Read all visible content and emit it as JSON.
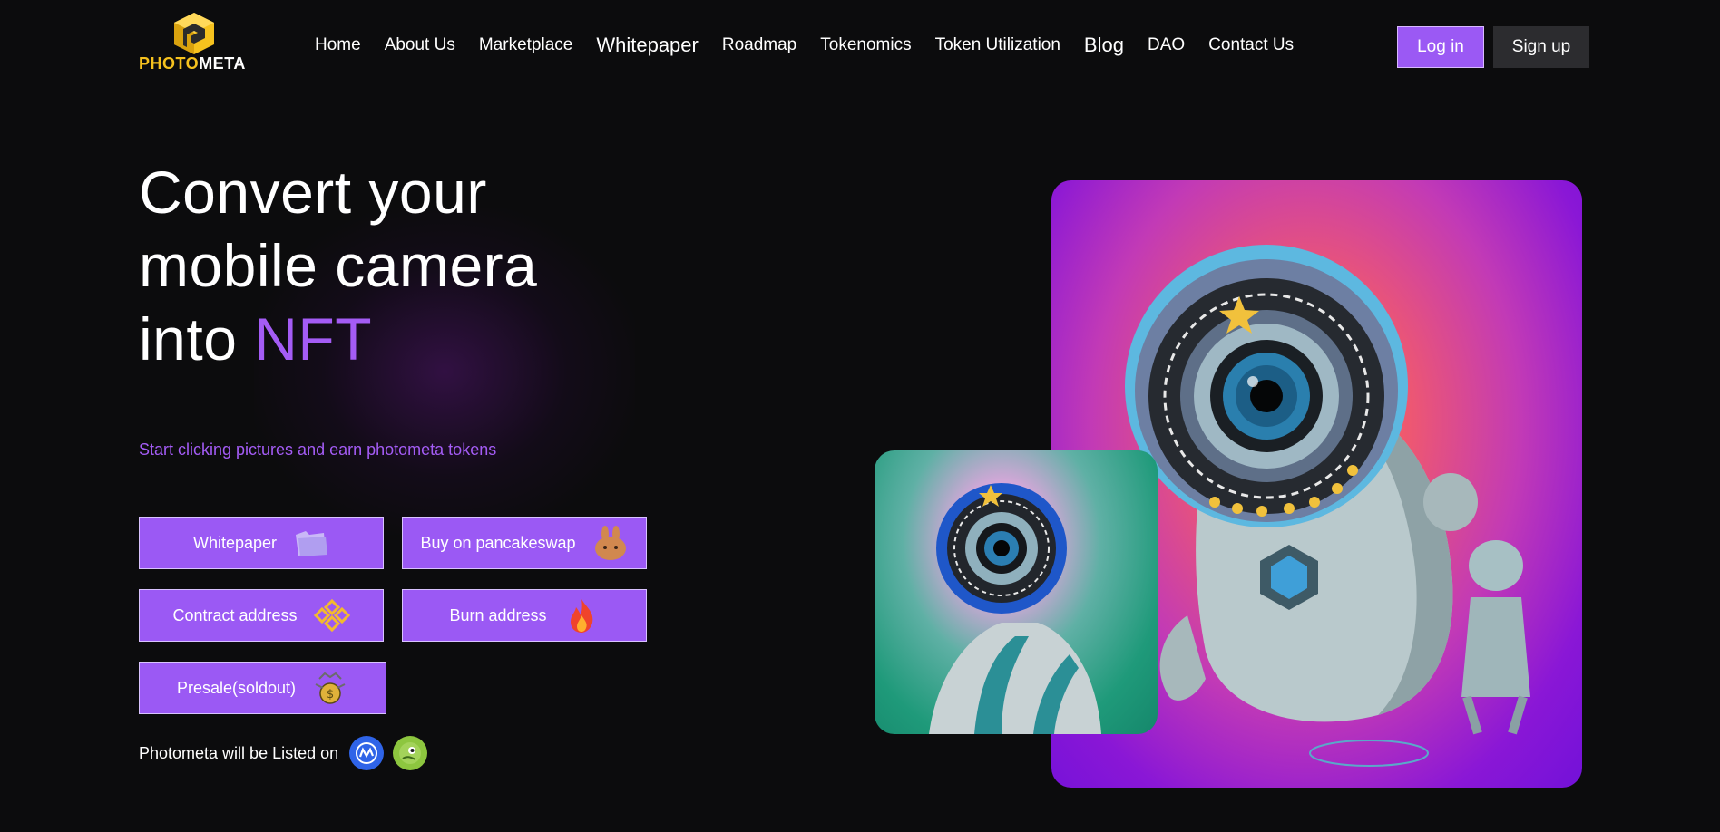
{
  "header": {
    "logo_text_accent": "PHOTO",
    "logo_text_main": "META",
    "nav": [
      "Home",
      "About Us",
      "Marketplace",
      "Whitepaper",
      "Roadmap",
      "Tokenomics",
      "Token Utilization",
      "Blog",
      "DAO",
      "Contact Us"
    ],
    "login_label": "Log in",
    "signup_label": "Sign up"
  },
  "hero": {
    "headline_line1": "Convert your",
    "headline_line2": "mobile camera",
    "headline_line3_prefix": "into",
    "headline_accent": "NFT",
    "subtitle": "Start clicking pictures and earn photometa tokens",
    "buttons": [
      {
        "label": "Whitepaper",
        "icon": "folder-icon"
      },
      {
        "label": "Buy on pancakeswap",
        "icon": "pancakeswap-bunny-icon"
      },
      {
        "label": "Contract address",
        "icon": "binance-icon"
      },
      {
        "label": "Burn address",
        "icon": "fire-icon"
      },
      {
        "label": "Presale(soldout)",
        "icon": "money-bag-icon"
      }
    ],
    "listed_label": "Photometa will be Listed on",
    "listed_icons": [
      "coinmarketcap-icon",
      "coingecko-icon"
    ]
  },
  "colors": {
    "background": "#0c0c0d",
    "accent": "#9b59f4",
    "accent_text": "#a45cf5",
    "logo_gold": "#f6c21e",
    "signup_bg": "#2c2c2f"
  }
}
